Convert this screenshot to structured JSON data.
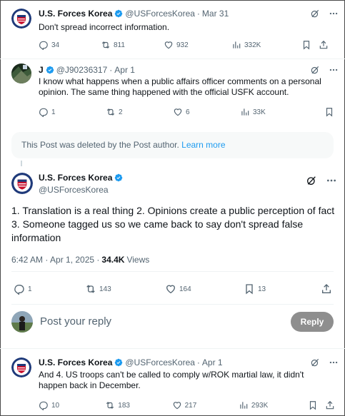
{
  "post1": {
    "author_name": "U.S. Forces Korea",
    "handle": "@USForcesKorea",
    "date": "Mar 31",
    "text": "Don't spread incorrect information.",
    "replies": "34",
    "reposts": "811",
    "likes": "932",
    "views": "332K"
  },
  "post2": {
    "author_name": "J",
    "handle": "@J90236317",
    "date": "Apr 1",
    "text_line1": "I know what happens when a public affairs officer comments on a personal",
    "text_line2": "opinion. The same thing happened with the official USFK account.",
    "replies": "1",
    "reposts": "2",
    "likes": "6",
    "views": "33K"
  },
  "deleted": {
    "text": "This Post was deleted by the Post author.",
    "link": "Learn more"
  },
  "main_post": {
    "author_name": "U.S. Forces Korea",
    "handle": "@USForcesKorea",
    "text_line1": "1. Translation is a real thing 2. Opinions create a public perception of fact",
    "text_line2": "3. Someone tagged us so we came back to say don't spread false",
    "text_line3": "information",
    "timestamp": "6:42 AM · Apr 1, 2025 ·",
    "views_count": "34.4K",
    "views_label": "Views",
    "replies": "1",
    "reposts": "143",
    "likes": "164",
    "bookmarks": "13"
  },
  "reply_box": {
    "placeholder": "Post your reply",
    "button": "Reply"
  },
  "post4": {
    "author_name": "U.S. Forces Korea",
    "handle": "@USForcesKorea",
    "date": "Apr 1",
    "text_line1": "And 4. US troops can't be called to comply w/ROK martial law, it didn't",
    "text_line2": "happen back in December.",
    "replies": "10",
    "reposts": "183",
    "likes": "217",
    "views": "293K"
  },
  "colors": {
    "verified": "#1d9bf0",
    "text_primary": "#0f1419",
    "text_muted": "#536471",
    "reply_button": "#8e8e8e"
  },
  "icons": [
    "verified-badge-icon",
    "grok-icon",
    "more-icon",
    "reply-icon",
    "repost-icon",
    "like-icon",
    "views-icon",
    "bookmark-icon",
    "share-icon"
  ]
}
